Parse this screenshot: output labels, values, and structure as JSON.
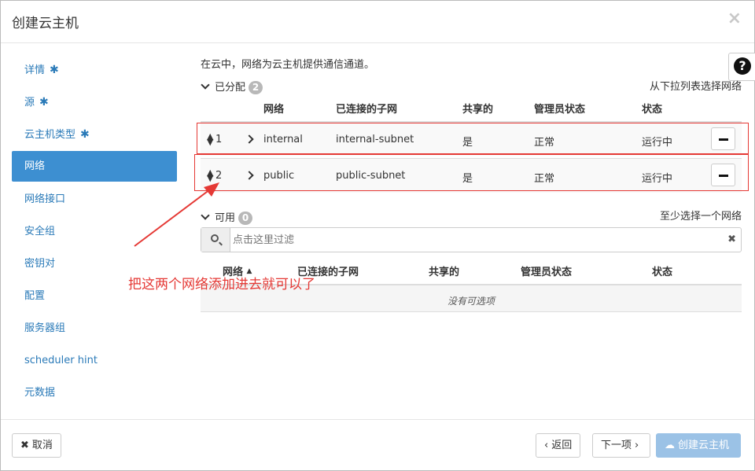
{
  "modal": {
    "title": "创建云主机",
    "close_icon": "×"
  },
  "sidebar": {
    "items": [
      {
        "label": "详情",
        "required": true
      },
      {
        "label": "源",
        "required": true
      },
      {
        "label": "云主机类型",
        "required": true
      },
      {
        "label": "网络",
        "required": false,
        "active": true
      },
      {
        "label": "网络接口",
        "required": false
      },
      {
        "label": "安全组",
        "required": false
      },
      {
        "label": "密钥对",
        "required": false
      },
      {
        "label": "配置",
        "required": false
      },
      {
        "label": "服务器组",
        "required": false
      },
      {
        "label": "scheduler hint",
        "required": false
      },
      {
        "label": "元数据",
        "required": false
      }
    ],
    "required_mark": "✱"
  },
  "main": {
    "intro": "在云中，网络为云主机提供通信通道。",
    "help_icon": "?",
    "allocated": {
      "label": "已分配",
      "count": "2",
      "hint": "从下拉列表选择网络",
      "columns": [
        "网络",
        "已连接的子网",
        "共享的",
        "管理员状态",
        "状态"
      ],
      "rows": [
        {
          "index": "1",
          "network": "internal",
          "subnet": "internal-subnet",
          "shared": "是",
          "admin_state": "正常",
          "status": "运行中"
        },
        {
          "index": "2",
          "network": "public",
          "subnet": "public-subnet",
          "shared": "是",
          "admin_state": "正常",
          "status": "运行中"
        }
      ]
    },
    "available": {
      "label": "可用",
      "count": "0",
      "hint": "至少选择一个网络",
      "filter_placeholder": "点击这里过滤",
      "columns": [
        "网络",
        "已连接的子网",
        "共享的",
        "管理员状态",
        "状态"
      ],
      "empty_text": "没有可选项"
    },
    "annotation": "把这两个网络添加进去就可以了"
  },
  "footer": {
    "cancel": "取消",
    "back": "返回",
    "next": "下一项",
    "create": "创建云主机"
  },
  "colors": {
    "accent": "#3d8fd1",
    "annotation_red": "#e53935",
    "primary_disabled": "#9bc2e6"
  }
}
